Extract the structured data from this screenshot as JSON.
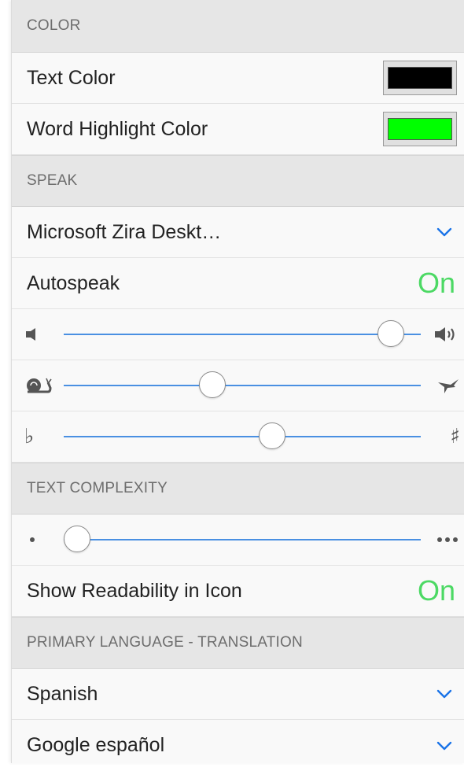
{
  "color": {
    "header": "COLOR",
    "text_color_label": "Text Color",
    "text_color_value": "#000000",
    "highlight_label": "Word Highlight Color",
    "highlight_value": "#00ff00"
  },
  "speak": {
    "header": "SPEAK",
    "voice": "Microsoft Zira Deskt…",
    "autospeak_label": "Autospeak",
    "autospeak_state": "On",
    "volume_level": 0.95,
    "speed_level": 0.41,
    "pitch_level": 0.59,
    "icons": {
      "volume_low": "volume-low-icon",
      "volume_high": "volume-high-icon",
      "speed_slow": "snail-icon",
      "speed_fast": "bird-icon",
      "pitch_low": "flat-icon",
      "pitch_high": "sharp-icon"
    }
  },
  "complexity": {
    "header": "TEXT COMPLEXITY",
    "level": 0.0,
    "readability_label": "Show Readability in Icon",
    "readability_state": "On",
    "icons": {
      "low": "single-dot-icon",
      "high": "three-dots-icon"
    }
  },
  "language": {
    "header": "PRIMARY LANGUAGE - TRANSLATION",
    "language": "Spanish",
    "voice": "Google español"
  },
  "colors": {
    "toggle_on": "#4cd964",
    "slider_track": "#4a90e2",
    "chevron": "#1a73e8",
    "header_bg": "#e6e6e6"
  }
}
